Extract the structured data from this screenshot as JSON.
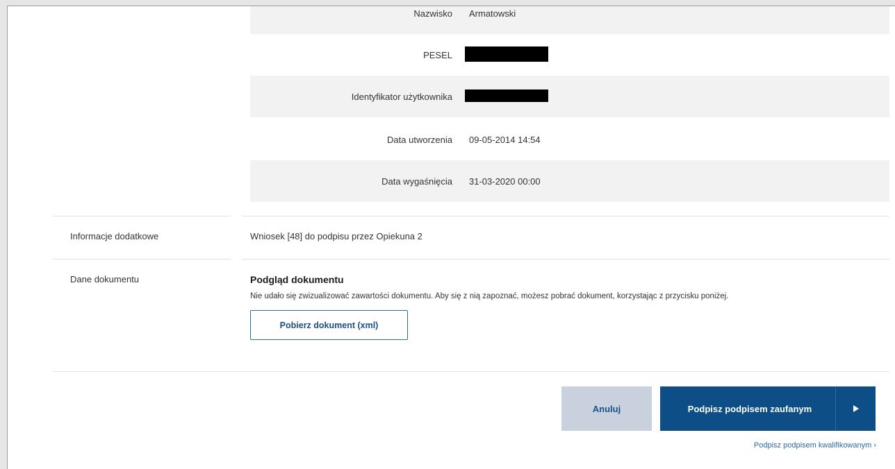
{
  "details": {
    "rows": [
      {
        "label": "Nazwisko",
        "value": "Armatowski"
      },
      {
        "label": "PESEL",
        "value": ""
      },
      {
        "label": "Identyfikator użytkownika",
        "value": ""
      },
      {
        "label": "Data utworzenia",
        "value": "09-05-2014 14:54"
      },
      {
        "label": "Data wygaśnięcia",
        "value": "31-03-2020 00:00"
      }
    ]
  },
  "additional_info": {
    "label": "Informacje dodatkowe",
    "value": "Wniosek [48] do podpisu przez Opiekuna 2"
  },
  "document": {
    "label": "Dane dokumentu",
    "preview_title": "Podgląd dokumentu",
    "preview_text": "Nie udało się zwizualizować zawartości dokumentu. Aby się z nią zapoznać, możesz pobrać dokument, korzystając z przycisku poniżej.",
    "download_label": "Pobierz dokument (xml)"
  },
  "actions": {
    "cancel_label": "Anuluj",
    "sign_label": "Podpisz podpisem zaufanym",
    "qualified_link": "Podpisz podpisem kwalifikowanym ›"
  },
  "colors": {
    "primary": "#0c4e85",
    "cancel_bg": "#c9d1de",
    "link": "#2a6aa5"
  }
}
